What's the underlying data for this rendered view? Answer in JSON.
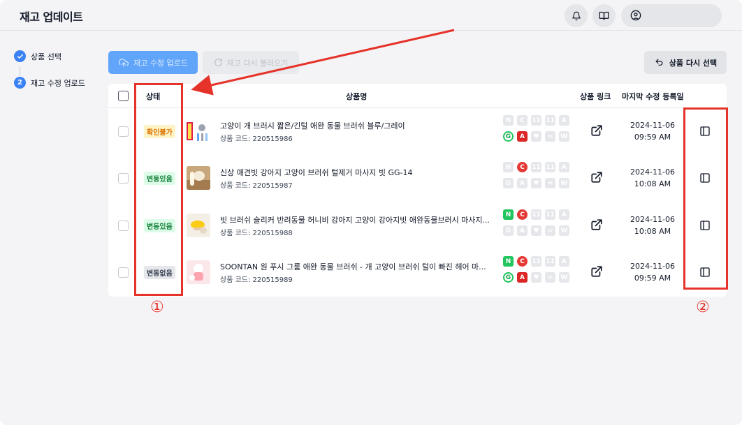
{
  "header": {
    "title": "재고 업데이트",
    "icons": [
      "bell-icon",
      "book-icon",
      "user-circle-icon"
    ]
  },
  "steps": [
    {
      "label": "상품 선택",
      "state": "done"
    },
    {
      "label": "재고 수정 업로드",
      "number": "2",
      "state": "current"
    }
  ],
  "toolbar": {
    "upload_label": "재고 수정 업로드",
    "reload_label": "재고 다시 불러오기",
    "reselect_label": "상품 다시 선택"
  },
  "table": {
    "columns": {
      "status": "상태",
      "product": "상품명",
      "link": "상품 링크",
      "modified": "마지막 수정 등록일"
    },
    "rows": [
      {
        "status": "확인불가",
        "status_tone": "yellow",
        "name": "고양이 개 브러시 짧은/긴털 애완 동물 브러쉬 블루/그레이",
        "code": "상품 코드: 220515986",
        "date": "2024-11-06",
        "time": "09:59 AM",
        "markets_top": [
          {
            "t": "N",
            "on": false
          },
          {
            "t": "C",
            "on": false
          },
          {
            "t": "11",
            "on": false
          },
          {
            "t": "11",
            "on": false
          },
          {
            "t": "A",
            "on": false
          }
        ],
        "markets_bottom": [
          {
            "t": "G",
            "on": true
          },
          {
            "t": "A",
            "on": true
          },
          {
            "t": "♥",
            "on": false
          },
          {
            "t": "∞",
            "on": false
          },
          {
            "t": "W",
            "on": false
          }
        ]
      },
      {
        "status": "변동있음",
        "status_tone": "green",
        "name": "신상 애견빗 강아지 고양이 브러쉬 털제거 마사지 빗 GG-14",
        "code": "상품 코드: 220515987",
        "date": "2024-11-06",
        "time": "10:08 AM",
        "markets_top": [
          {
            "t": "N",
            "on": false
          },
          {
            "t": "C",
            "on": true
          },
          {
            "t": "11",
            "on": false
          },
          {
            "t": "11",
            "on": false
          },
          {
            "t": "A",
            "on": false
          }
        ],
        "markets_bottom": [
          {
            "t": "G",
            "on": false
          },
          {
            "t": "A",
            "on": false
          },
          {
            "t": "♥",
            "on": false
          },
          {
            "t": "∞",
            "on": false
          },
          {
            "t": "W",
            "on": false
          }
        ]
      },
      {
        "status": "변동있음",
        "status_tone": "green",
        "name": "빗 브러쉬 슬리커 반려동물 허니비 강아지 고양이 강아지빗 애완동물브러시 마사지...",
        "code": "상품 코드: 220515988",
        "date": "2024-11-06",
        "time": "10:08 AM",
        "markets_top": [
          {
            "t": "N",
            "on": true
          },
          {
            "t": "C",
            "on": true
          },
          {
            "t": "11",
            "on": false
          },
          {
            "t": "11",
            "on": false
          },
          {
            "t": "A",
            "on": false
          }
        ],
        "markets_bottom": [
          {
            "t": "G",
            "on": false
          },
          {
            "t": "A",
            "on": false
          },
          {
            "t": "♥",
            "on": false
          },
          {
            "t": "∞",
            "on": false
          },
          {
            "t": "W",
            "on": false
          }
        ]
      },
      {
        "status": "변동없음",
        "status_tone": "gray",
        "name": "SOONTAN 원 푸시 그룸 애완 동물 브러쉬 - 개 고양이 브러쉬 털이 빠진 헤어 마...",
        "code": "상품 코드: 220515989",
        "date": "2024-11-06",
        "time": "09:59 AM",
        "markets_top": [
          {
            "t": "N",
            "on": true
          },
          {
            "t": "C",
            "on": true
          },
          {
            "t": "11",
            "on": false
          },
          {
            "t": "11",
            "on": false
          },
          {
            "t": "A",
            "on": false
          }
        ],
        "markets_bottom": [
          {
            "t": "G",
            "on": true
          },
          {
            "t": "A",
            "on": true
          },
          {
            "t": "♥",
            "on": false
          },
          {
            "t": "∞",
            "on": false
          },
          {
            "t": "W",
            "on": false
          }
        ]
      }
    ]
  },
  "annotations": {
    "one": "①",
    "two": "②"
  },
  "colors": {
    "primary": "#3b82f6",
    "annotation": "#e5332a",
    "naver": "#22c55e",
    "coupang": "#e53935",
    "gmarket": "#16a34a",
    "auction": "#dc2626"
  }
}
